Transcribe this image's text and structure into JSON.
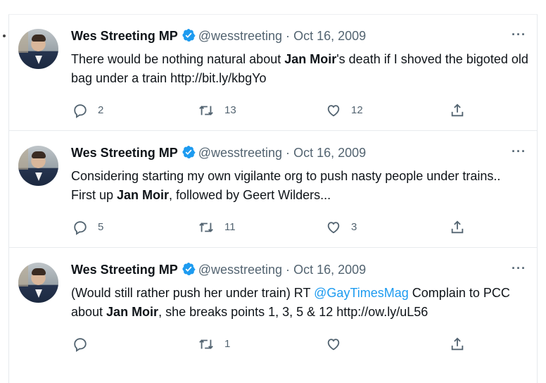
{
  "tweets": [
    {
      "name": "Wes Streeting MP",
      "handle": "@wesstreeting",
      "dot": "·",
      "date": "Oct 16, 2009",
      "text_parts": [
        "There would be nothing natural about ",
        "Jan Moir",
        "'s death if I shoved the bigoted old bag under a train http://bit.ly/kbgYo"
      ],
      "replies": "2",
      "retweets": "13",
      "likes": "12"
    },
    {
      "name": "Wes Streeting MP",
      "handle": "@wesstreeting",
      "dot": "·",
      "date": "Oct 16, 2009",
      "text_parts": [
        "Considering starting my own vigilante org to push nasty people under trains.. First up ",
        "Jan Moir",
        ", followed by Geert Wilders..."
      ],
      "replies": "5",
      "retweets": "11",
      "likes": "3"
    },
    {
      "name": "Wes Streeting MP",
      "handle": "@wesstreeting",
      "dot": "·",
      "date": "Oct 16, 2009",
      "text_parts": [
        "(Would still rather push her under train) RT ",
        "@GayTimesMag",
        " Complain to PCC about ",
        "Jan Moir",
        ", she breaks points 1, 3, 5 & 12 http://ow.ly/uL56"
      ],
      "replies": "",
      "retweets": "1",
      "likes": ""
    }
  ],
  "more_label": "···",
  "colors": {
    "verified": "#1d9bf0",
    "link": "#1d9bf0",
    "muted": "#536471"
  },
  "icons": {
    "reply": "reply-icon",
    "retweet": "retweet-icon",
    "like": "heart-icon",
    "share": "share-icon",
    "verified": "verified-badge-icon",
    "more": "more-icon"
  }
}
